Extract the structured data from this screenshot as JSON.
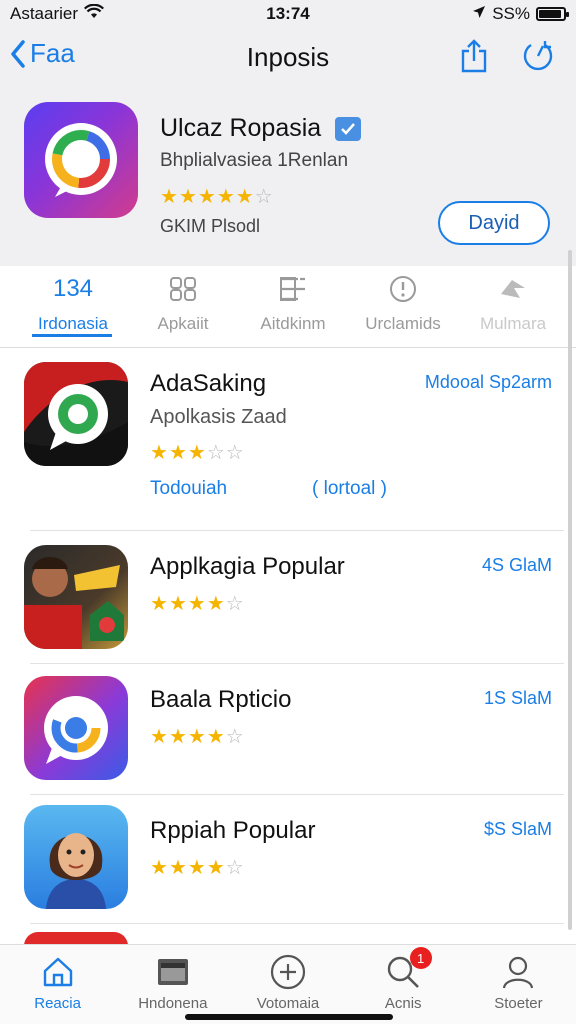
{
  "status_bar": {
    "carrier": "Astaarier",
    "time": "13:74",
    "battery_text": "SS%",
    "battery_level": 0.9
  },
  "nav": {
    "back_label": "Faa",
    "title": "Inposis",
    "icons": [
      "share-icon",
      "refresh-icon"
    ]
  },
  "hero": {
    "name": "Ulcaz Ropasia",
    "subtitle": "Bhplialvasiea 1Renlan",
    "rating": 4.5,
    "developer": "GKIM Plsodl",
    "get_label": "Dayid"
  },
  "tabs": [
    {
      "icon_text": "134",
      "label": "Irdonasia",
      "active": true
    },
    {
      "icon_text": "⌂",
      "icon": "grid-icon",
      "label": "Apkaiit",
      "active": false
    },
    {
      "icon_text": "☰",
      "icon": "list-icon",
      "label": "Aitdkinm",
      "active": false
    },
    {
      "icon_text": "ⓘ",
      "icon": "info-icon",
      "label": "Urclamids",
      "active": false
    },
    {
      "icon_text": "✦",
      "icon": "bird-icon",
      "label": "Mulmara",
      "active": false
    }
  ],
  "apps": [
    {
      "name": "AdaSaking",
      "subtitle": "Apolkasis Zaad",
      "rating": 3,
      "meta": "Mdooal Sp2arm",
      "link_left": "Todouiah",
      "link_right": "( lortoal )"
    },
    {
      "name": "Applkagia Popular",
      "rating": 4,
      "meta": "4S GlaM"
    },
    {
      "name": "Baala Rpticio",
      "rating": 4,
      "meta": "1S SlaM"
    },
    {
      "name": "Rppiah Popular",
      "rating": 4,
      "meta": "$S SlaM"
    }
  ],
  "tab_bar": [
    {
      "label": "Reacia",
      "icon": "home-icon",
      "active": true
    },
    {
      "label": "Hndonena",
      "icon": "apps-icon",
      "active": false
    },
    {
      "label": "Votomaia",
      "icon": "plus-circle-icon",
      "active": false
    },
    {
      "label": "Acnis",
      "icon": "search-icon",
      "active": false,
      "badge": "1"
    },
    {
      "label": "Stoeter",
      "icon": "person-icon",
      "active": false
    }
  ],
  "colors": {
    "accent": "#1a7ee6",
    "star": "#f4b400",
    "badge": "#e82020"
  }
}
